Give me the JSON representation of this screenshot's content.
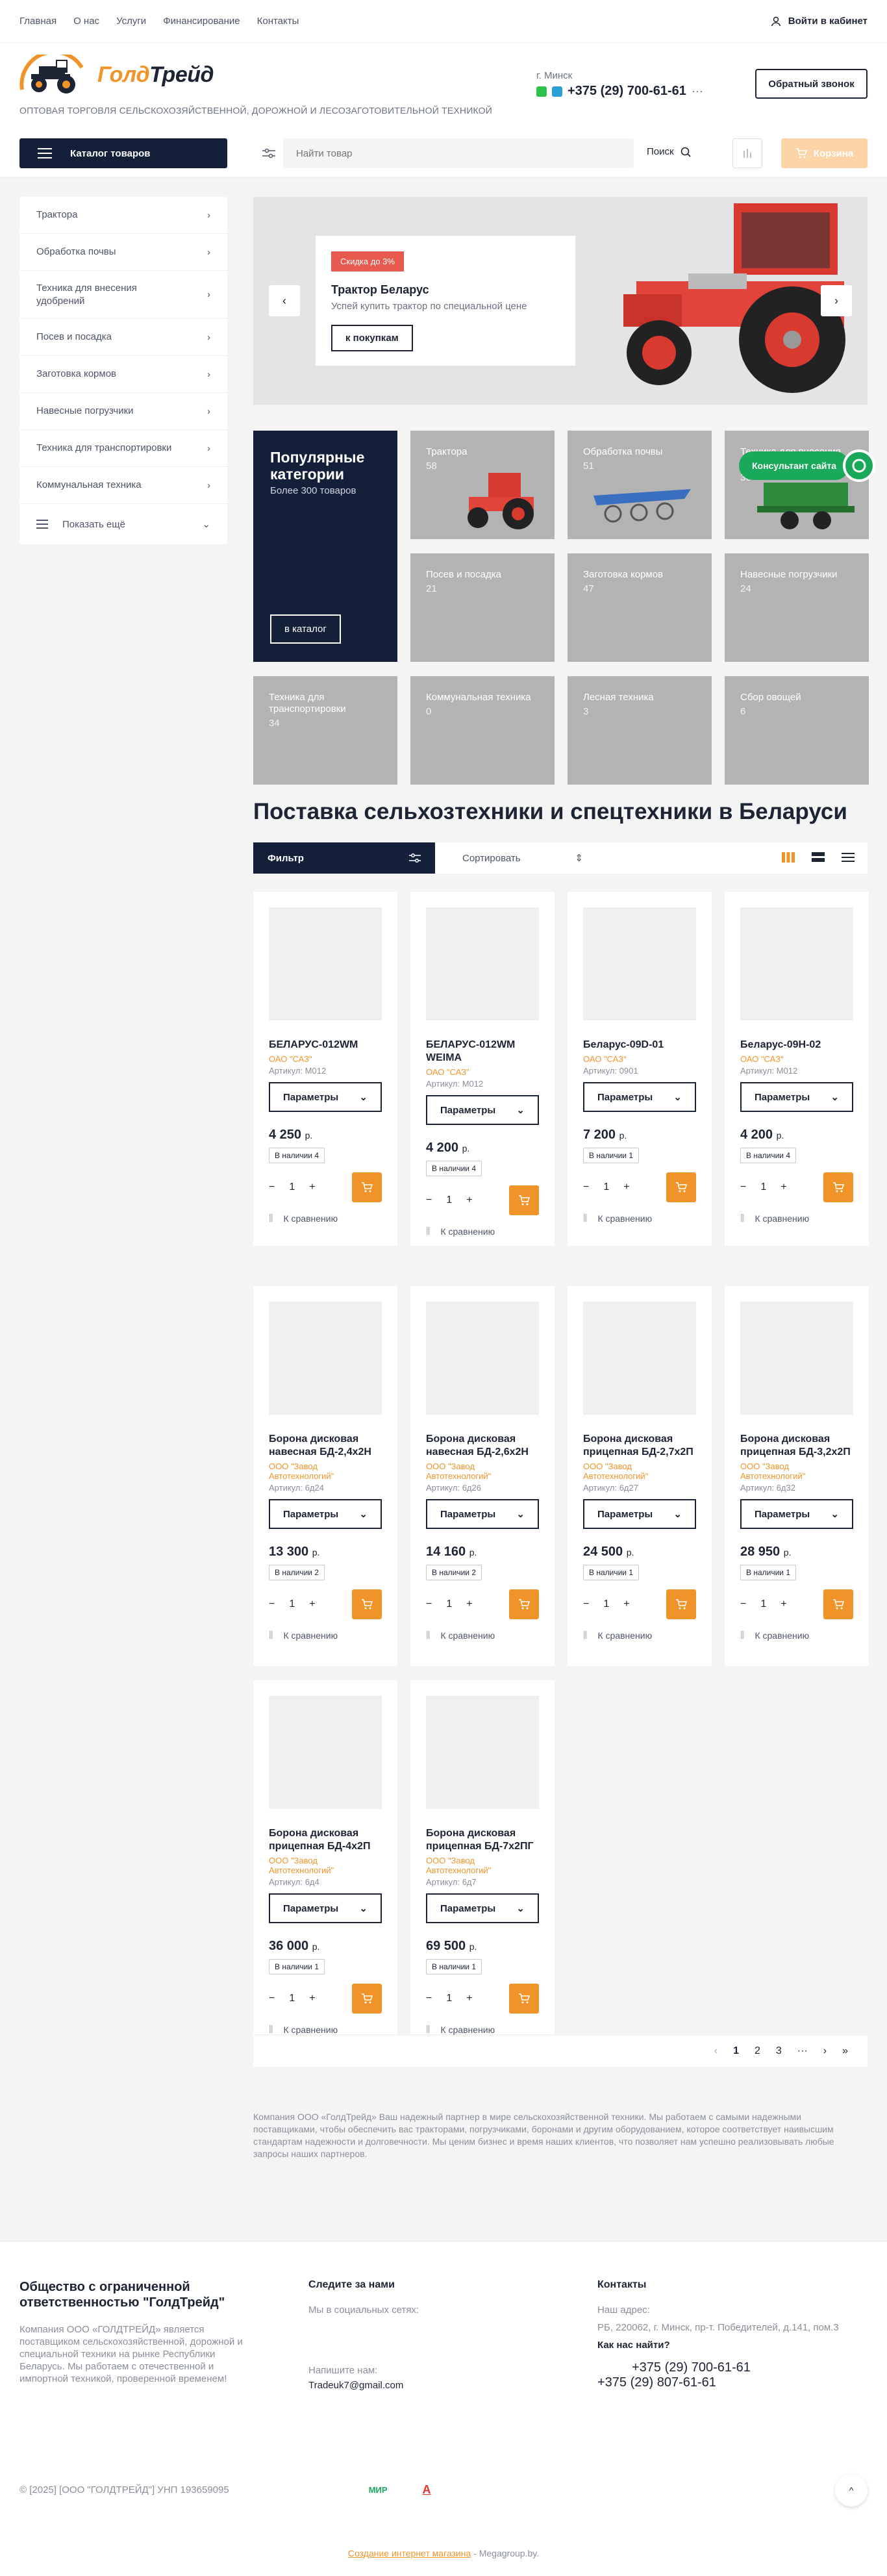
{
  "topnav": [
    "Главная",
    "О нас",
    "Услуги",
    "Финансирование",
    "Контакты"
  ],
  "login": "Войти в кабинет",
  "logo": {
    "part1": "Голд",
    "part2": "Трейд"
  },
  "tagline": "ОПТОВАЯ ТОРГОВЛЯ СЕЛЬСКОХОЗЯЙСТВЕННОЙ, ДОРОЖНОЙ И ЛЕСОЗАГОТОВИТЕЛЬНОЙ ТЕХНИКОЙ",
  "contact": {
    "city": "г. Минск",
    "phone": "+375 (29) 700-61-61"
  },
  "callback": "Обратный звонок",
  "catalog_btn": "Каталог товаров",
  "search": {
    "placeholder": "Найти товар",
    "button": "Поиск"
  },
  "cart": "Корзина",
  "sidebar": {
    "items": [
      "Трактора",
      "Обработка почвы",
      "Техника для внесения удобрений",
      "Посев и посадка",
      "Заготовка кормов",
      "Навесные погрузчики",
      "Техника для транспортировки",
      "Коммунальная техника"
    ],
    "more": "Показать ещё"
  },
  "banner": {
    "badge": "Скидка до 3%",
    "title": "Трактор Беларус",
    "text": "Успей купить трактор по специальной цене",
    "button": "к покупкам"
  },
  "popular": {
    "title": "Популярные категории",
    "subtitle": "Более 300 товаров",
    "button": "в каталог"
  },
  "categories": [
    {
      "name": "Трактора",
      "count": "58"
    },
    {
      "name": "Обработка почвы",
      "count": "51"
    },
    {
      "name": "Техника для внесения удобрений",
      "count": "36"
    },
    {
      "name": "Посев и посадка",
      "count": "21"
    },
    {
      "name": "Заготовка кормов",
      "count": "47"
    },
    {
      "name": "Навесные погрузчики",
      "count": "24"
    },
    {
      "name": "Техника для транспортировки",
      "count": "34"
    },
    {
      "name": "Коммунальная техника",
      "count": "0"
    },
    {
      "name": "Лесная техника",
      "count": "3"
    },
    {
      "name": "Сбор овощей",
      "count": "6"
    }
  ],
  "consultant": "Консультант сайта",
  "section_title": "Поставка сельхозтехники и спецтехники в Беларуси",
  "filter": "Фильтр",
  "sort": "Сортировать",
  "product_ui": {
    "params": "Параметры",
    "currency": "р.",
    "compare": "К сравнению"
  },
  "products": [
    {
      "name": "БЕЛАРУС-012WM",
      "maker": "ОАО \"САЗ\"",
      "article": "Артикул: М012",
      "price": "4 250",
      "stock": "В наличии 4",
      "qty": "1"
    },
    {
      "name": "БЕЛАРУС-012WM WEIMA",
      "maker": "ОАО \"САЗ\"",
      "article": "Артикул: М012",
      "price": "4 200",
      "stock": "В наличии 4",
      "qty": "1"
    },
    {
      "name": "Беларус-09D-01",
      "maker": "ОАО \"САЗ\"",
      "article": "Артикул: 0901",
      "price": "7 200",
      "stock": "В наличии 1",
      "qty": "1"
    },
    {
      "name": "Беларус-09Н-02",
      "maker": "ОАО \"САЗ\"",
      "article": "Артикул: М012",
      "price": "4 200",
      "stock": "В наличии 4",
      "qty": "1"
    },
    {
      "name": "Борона дисковая навесная БД-2,4х2Н",
      "maker": "ООО \"Завод Автотехнологий\"",
      "article": "Артикул: 6д24",
      "price": "13 300",
      "stock": "В наличии 2",
      "qty": "1"
    },
    {
      "name": "Борона дисковая навесная БД-2,6х2Н",
      "maker": "ООО \"Завод Автотехнологий\"",
      "article": "Артикул: 6д26",
      "price": "14 160",
      "stock": "В наличии 2",
      "qty": "1"
    },
    {
      "name": "Борона дисковая прицепная БД-2,7х2П",
      "maker": "ООО \"Завод Автотехнологий\"",
      "article": "Артикул: 6д27",
      "price": "24 500",
      "stock": "В наличии 1",
      "qty": "1"
    },
    {
      "name": "Борона дисковая прицепная БД-3,2х2П",
      "maker": "ООО \"Завод Автотехнологий\"",
      "article": "Артикул: 6д32",
      "price": "28 950",
      "stock": "В наличии 1",
      "qty": "1"
    },
    {
      "name": "Борона дисковая прицепная БД-4х2П",
      "maker": "ООО \"Завод Автотехнологий\"",
      "article": "Артикул: 6д4",
      "price": "36 000",
      "stock": "В наличии 1",
      "qty": "1"
    },
    {
      "name": "Борона дисковая прицепная БД-7х2ПГ",
      "maker": "ООО \"Завод Автотехнологий\"",
      "article": "Артикул: 6д7",
      "price": "69 500",
      "stock": "В наличии 1",
      "qty": "1"
    }
  ],
  "pager": {
    "p1": "1",
    "p2": "2",
    "p3": "3",
    "dots": "···"
  },
  "about": "Компания ООО «ГолдТрейд» Ваш надежный партнер в мире сельскохозяйственной техники. Мы работаем с самыми надежными поставщиками, чтобы обеспечить вас тракторами, погрузчиками, боронами и другим оборудованием, которое соответствует наивысшим стандартам надежности и долговечности. Мы ценим бизнес и время наших клиентов, что позволяет нам успешно реализовывать любые запросы наших партнеров.",
  "footer": {
    "company": "Общество с ограниченной ответственностью \"ГолдТрейд\"",
    "company_text": "Компания ООО «ГОЛДТРЕЙД» является поставщиком сельскохозяйственной, дорожной и специальной техники на рынке Республики Беларусь. Мы работаем с отечественной и импортной техникой, проверенной временем!",
    "follow_title": "Следите за нами",
    "social": "Мы в социальных сетях:",
    "write": "Напишите нам:",
    "email": "Tradeuk7@gmail.com",
    "contacts_title": "Контакты",
    "address_label": "Наш адрес:",
    "address": "РБ, 220062, г. Минск, пр-т. Победителей, д.141, пом.3",
    "find": "Как нас найти?",
    "phone1": "+375 (29) 700-61-61",
    "phone2": "+375 (29) 807-61-61",
    "copyright": "© [2025] [ООО \"ГОЛДТРЕЙД\"] УНП 193659095",
    "pay1": "МИР",
    "dev_link": "Создание интернет магазина",
    "dev_suffix": " - Megagroup.by."
  }
}
